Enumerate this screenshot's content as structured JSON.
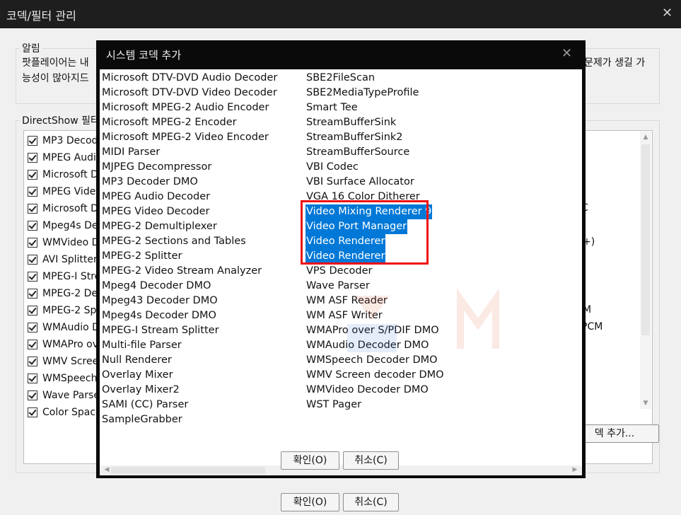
{
  "outer_window": {
    "title": "코덱/필터 관리",
    "close_symbol": "✕",
    "notice": {
      "legend": "알림",
      "line1": "팟플레이어는 내",
      "line1_right": "문제가 생길 가",
      "line2": "능성이 많아지드"
    },
    "filters_group": {
      "legend": "DirectShow 필터",
      "items": [
        {
          "label": "MP3 Decod",
          "checked": true
        },
        {
          "label": "MPEG Audi",
          "checked": true
        },
        {
          "label": "Microsoft D",
          "checked": true
        },
        {
          "label": "MPEG Vide",
          "checked": true
        },
        {
          "label": "Microsoft D",
          "checked": true
        },
        {
          "label": "Mpeg4s De",
          "checked": true
        },
        {
          "label": "WMVideo D",
          "checked": true
        },
        {
          "label": "AVI Splitter",
          "checked": true
        },
        {
          "label": "MPEG-I Stre",
          "checked": true
        },
        {
          "label": "MPEG-2 De",
          "checked": true
        },
        {
          "label": "MPEG-2 Sp",
          "checked": true
        },
        {
          "label": "WMAudio D",
          "checked": true
        },
        {
          "label": "WMAPro ov",
          "checked": true
        },
        {
          "label": "WMV Scree",
          "checked": true
        },
        {
          "label": "WMSpeech",
          "checked": true
        },
        {
          "label": "Wave Parse",
          "checked": true
        },
        {
          "label": "Color Space",
          "checked": true
        }
      ],
      "right_fragments": [
        "C",
        "+)",
        "M",
        "PCM"
      ]
    },
    "add_codec_button": "덱 추가...",
    "ok_button": "확인(O)",
    "cancel_button": "취소(C)"
  },
  "dialog": {
    "title": "시스템 코덱 추가",
    "close_symbol": "✕",
    "column_left": [
      "Microsoft DTV-DVD Audio Decoder",
      "Microsoft DTV-DVD Video Decoder",
      "Microsoft MPEG-2 Audio Encoder",
      "Microsoft MPEG-2 Encoder",
      "Microsoft MPEG-2 Video Encoder",
      "MIDI Parser",
      "MJPEG Decompressor",
      "MP3 Decoder DMO",
      "MPEG Audio Decoder",
      "MPEG Video Decoder",
      "MPEG-2 Demultiplexer",
      "MPEG-2 Sections and Tables",
      "MPEG-2 Splitter",
      "MPEG-2 Video Stream Analyzer",
      "Mpeg4 Decoder DMO",
      "Mpeg43 Decoder DMO",
      "Mpeg4s Decoder DMO",
      "MPEG-I Stream Splitter",
      "Multi-file Parser",
      "Null Renderer",
      "Overlay Mixer",
      "Overlay Mixer2",
      "SAMI (CC) Parser",
      "SampleGrabber"
    ],
    "column_right": [
      {
        "label": "SBE2FileScan",
        "selected": false
      },
      {
        "label": "SBE2MediaTypeProfile",
        "selected": false
      },
      {
        "label": "Smart Tee",
        "selected": false
      },
      {
        "label": "StreamBufferSink",
        "selected": false
      },
      {
        "label": "StreamBufferSink2",
        "selected": false
      },
      {
        "label": "StreamBufferSource",
        "selected": false
      },
      {
        "label": "VBI Codec",
        "selected": false
      },
      {
        "label": "VBI Surface Allocator",
        "selected": false
      },
      {
        "label": "VGA 16 Color Ditherer",
        "selected": false
      },
      {
        "label": "Video Mixing Renderer 9",
        "selected": true
      },
      {
        "label": "Video Port Manager",
        "selected": true
      },
      {
        "label": "Video Renderer",
        "selected": true
      },
      {
        "label": "Video Renderer",
        "selected": true
      },
      {
        "label": "VPS Decoder",
        "selected": false
      },
      {
        "label": "Wave Parser",
        "selected": false
      },
      {
        "label": "WM ASF Reader",
        "selected": false
      },
      {
        "label": "WM ASF Writer",
        "selected": false
      },
      {
        "label": "WMAPro over S/PDIF DMO",
        "selected": false
      },
      {
        "label": "WMAudio Decoder DMO",
        "selected": false
      },
      {
        "label": "WMSpeech Decoder DMO",
        "selected": false
      },
      {
        "label": "WMV Screen decoder DMO",
        "selected": false
      },
      {
        "label": "WMVideo Decoder DMO",
        "selected": false
      },
      {
        "label": "WST Pager",
        "selected": false
      }
    ],
    "ok_button": "확인(O)",
    "cancel_button": "취소(C)"
  },
  "colors": {
    "selection": "#0078d7",
    "highlight_box": "#e11111",
    "titlebar": "#1e1e1e"
  }
}
